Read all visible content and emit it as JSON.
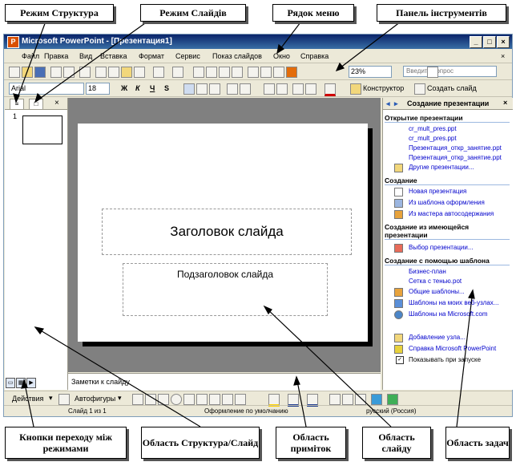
{
  "callouts": {
    "structure_mode": "Режим Структура",
    "slide_mode": "Режим Слайдів",
    "menu_row": "Рядок меню",
    "toolbar_panel": "Панель інструментів",
    "mode_buttons": "Кнопки переходу між режимами",
    "outline_area": "Область Структура/Слайд",
    "notes_area": "Область приміток",
    "slide_area": "Область слайду",
    "task_area": "Область задач"
  },
  "window": {
    "title": "Microsoft PowerPoint - [Презентация1]",
    "icon_letter": "P"
  },
  "menu": {
    "items": [
      "Файл",
      "Правка",
      "Вид",
      "Вставка",
      "Формат",
      "Сервис",
      "Показ слайдов",
      "Окно",
      "Справка"
    ],
    "question_placeholder": "Введите вопрос"
  },
  "toolbar": {
    "zoom": "23%",
    "font_name": "Arial",
    "font_size": "18",
    "bold": "Ж",
    "italic": "К",
    "underline": "Ч",
    "shadow": "S",
    "designer": "Конструктор",
    "create_slide": "Создать слайд"
  },
  "left_pane": {
    "slide_number": "1"
  },
  "slide": {
    "title_placeholder": "Заголовок слайда",
    "subtitle_placeholder": "Подзаголовок слайда"
  },
  "notes": {
    "placeholder": "Заметки к слайду"
  },
  "task_pane": {
    "title": "Создание презентации",
    "sections": {
      "open": "Открытие презентации",
      "create": "Создание",
      "from_existing": "Создание из имеющейся презентации",
      "from_template": "Создание с помощью шаблона"
    },
    "open_items": [
      "cr_mult_pres.ppt",
      "cr_mult_pres.ppt",
      "Презентация_откр_занятие.ppt",
      "Презентация_откр_занятие.ppt"
    ],
    "other_presentations": "Другие презентации...",
    "create_items": [
      "Новая презентация",
      "Из шаблона оформления",
      "Из мастера автосодержания"
    ],
    "choose_presentation": "Выбор презентации...",
    "template_items": [
      "Бизнес-план",
      "Сетка с тенью.pot"
    ],
    "general_templates": "Общие шаблоны...",
    "web_templates": "Шаблоны на моих веб-узлах...",
    "ms_templates": "Шаблоны на Microsoft.com",
    "add_node": "Добавление узла...",
    "help": "Справка Microsoft PowerPoint",
    "show_on_start": "Показывать при запуске"
  },
  "drawing_bar": {
    "actions": "Действия",
    "autoshapes": "Автофигуры"
  },
  "status": {
    "slide_count": "Слайд 1 из 1",
    "design": "Оформление по умолчанию",
    "language": "русский (Россия)"
  }
}
